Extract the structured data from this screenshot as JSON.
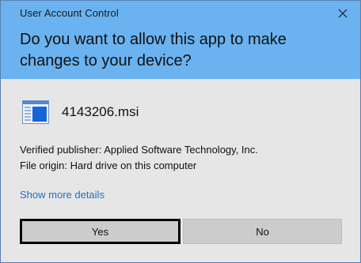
{
  "window": {
    "title": "User Account Control",
    "close_icon": "close-icon"
  },
  "header": {
    "question": "Do you want to allow this app to make changes to your device?",
    "background_color": "#6ab3f0"
  },
  "app": {
    "icon": "installer-window-icon",
    "name": "4143206.msi"
  },
  "details": {
    "publisher": "Verified publisher: Applied Software Technology, Inc.",
    "origin": "File origin: Hard drive on this computer"
  },
  "links": {
    "show_more": "Show more details"
  },
  "buttons": {
    "yes": "Yes",
    "no": "No"
  },
  "colors": {
    "link": "#1e6fc0",
    "button": "#cccccc",
    "body": "#e6e6e6"
  }
}
